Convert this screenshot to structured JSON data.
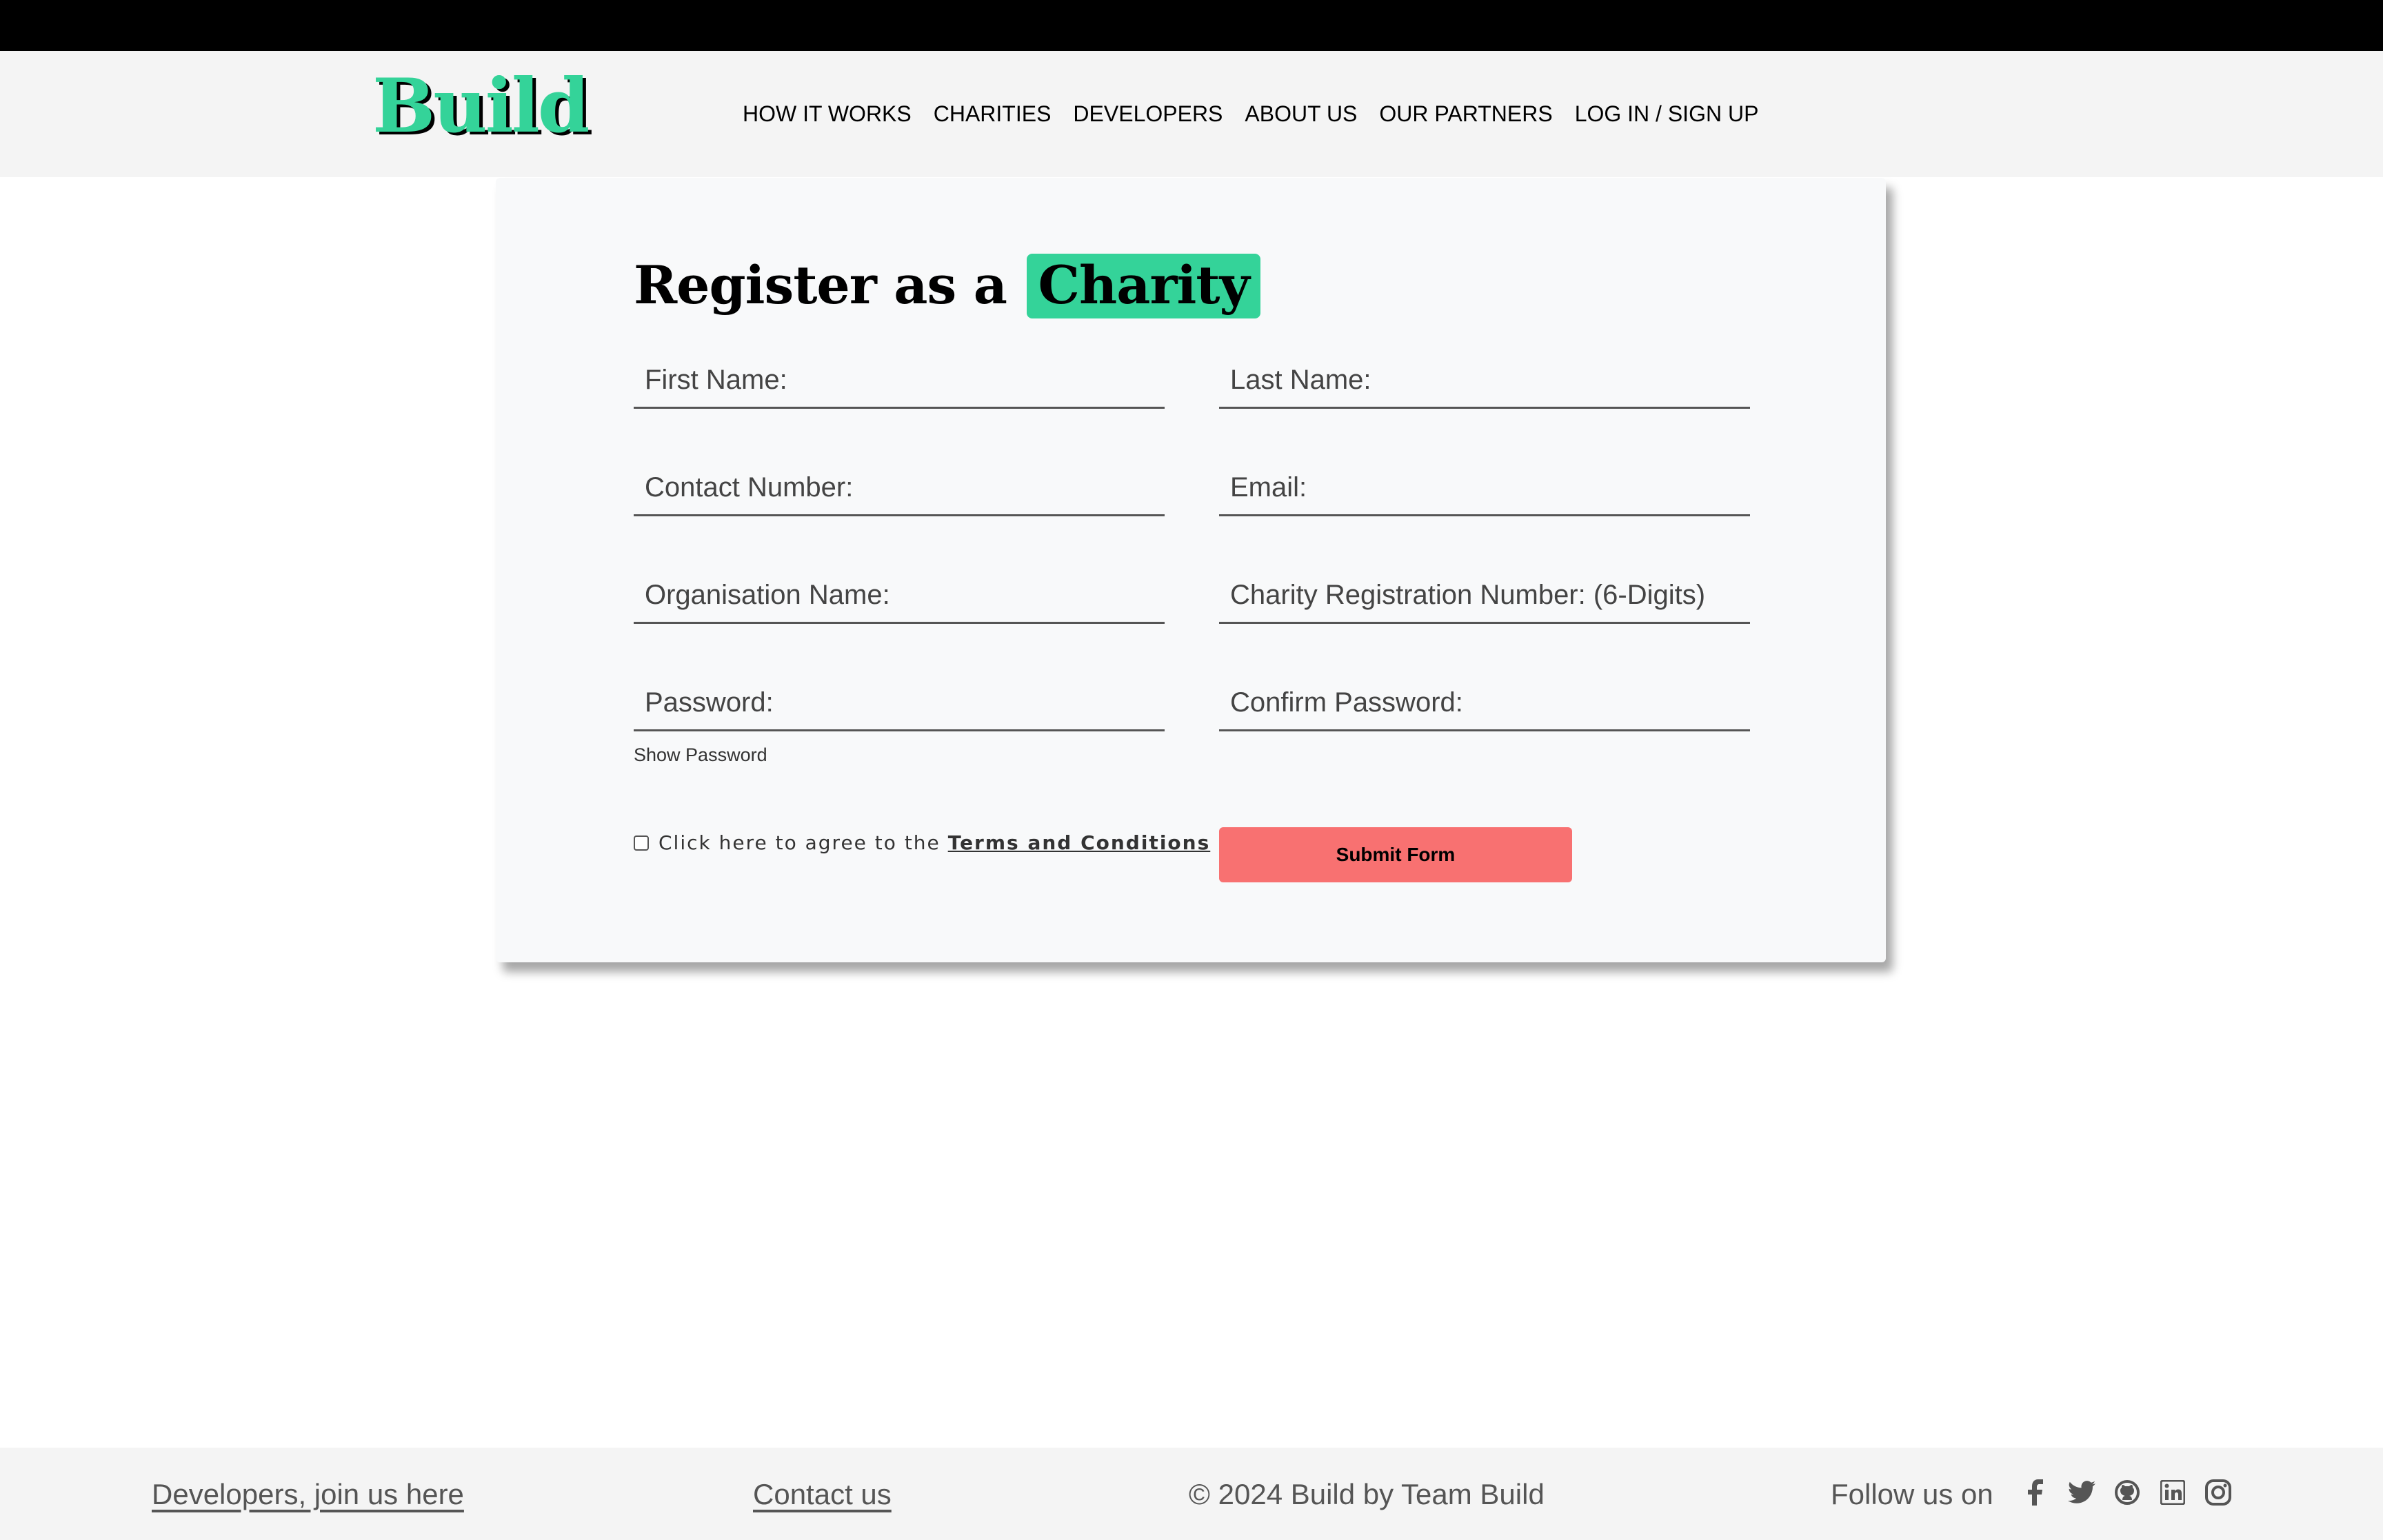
{
  "header": {
    "logo": "Build",
    "nav": [
      "HOW IT WORKS",
      "CHARITIES",
      "DEVELOPERS",
      "ABOUT US",
      "OUR PARTNERS",
      "LOG IN / SIGN UP"
    ]
  },
  "form": {
    "title_prefix": "Register as a",
    "title_highlight": "Charity",
    "fields": {
      "first_name": "First Name:",
      "last_name": "Last Name:",
      "contact_number": "Contact Number:",
      "email": "Email:",
      "organisation_name": "Organisation Name:",
      "charity_reg": "Charity Registration Number: (6-Digits)",
      "password": "Password:",
      "confirm_password": "Confirm Password:"
    },
    "show_password": "Show Password",
    "terms_prefix": "Click here to agree to the",
    "terms_link": "Terms and Conditions",
    "submit": "Submit Form"
  },
  "footer": {
    "developers_link": "Developers, join us here",
    "contact_link": "Contact us",
    "copyright": "© 2024 Build by Team Build",
    "follow": "Follow us on",
    "socials": [
      "facebook-icon",
      "twitter-icon",
      "github-icon",
      "linkedin-icon",
      "instagram-icon"
    ]
  },
  "colors": {
    "accent": "#34d399",
    "submit": "#f87171",
    "card": "#f8f9fa"
  }
}
